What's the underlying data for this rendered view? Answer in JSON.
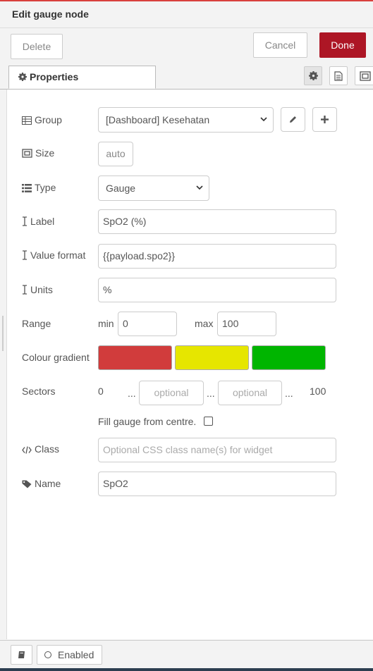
{
  "header": {
    "title": "Edit gauge node"
  },
  "toolbar": {
    "delete_label": "Delete",
    "cancel_label": "Cancel",
    "done_label": "Done"
  },
  "tabs": {
    "properties_label": "Properties",
    "icons": [
      "gear-icon",
      "description-icon",
      "appearance-icon"
    ]
  },
  "form": {
    "group": {
      "label": "Group",
      "value": "[Dashboard] Kesehatan"
    },
    "size": {
      "label": "Size",
      "value": "auto"
    },
    "type": {
      "label": "Type",
      "value": "Gauge"
    },
    "label": {
      "label": "Label",
      "value": "SpO2 (%)"
    },
    "value_format": {
      "label": "Value format",
      "value": "{{payload.spo2}}"
    },
    "units": {
      "label": "Units",
      "value": "%"
    },
    "range": {
      "label": "Range",
      "min_label": "min",
      "min_value": "0",
      "max_label": "max",
      "max_value": "100"
    },
    "colour_gradient": {
      "label": "Colour gradient",
      "colors": [
        "#d13c3c",
        "#e6e600",
        "#00b500"
      ]
    },
    "sectors": {
      "label": "Sectors",
      "start": "0",
      "dots": "...",
      "placeholder1": "optional",
      "placeholder2": "optional",
      "end": "100"
    },
    "fill_centre": {
      "label": "Fill gauge from centre.",
      "checked": false
    },
    "class": {
      "label": "Class",
      "placeholder": "Optional CSS class name(s) for widget"
    },
    "name": {
      "label": "Name",
      "value": "SpO2"
    }
  },
  "footer": {
    "enabled_label": "Enabled"
  },
  "colors": {
    "accent": "#ad1625",
    "top_line": "#d8403d"
  }
}
